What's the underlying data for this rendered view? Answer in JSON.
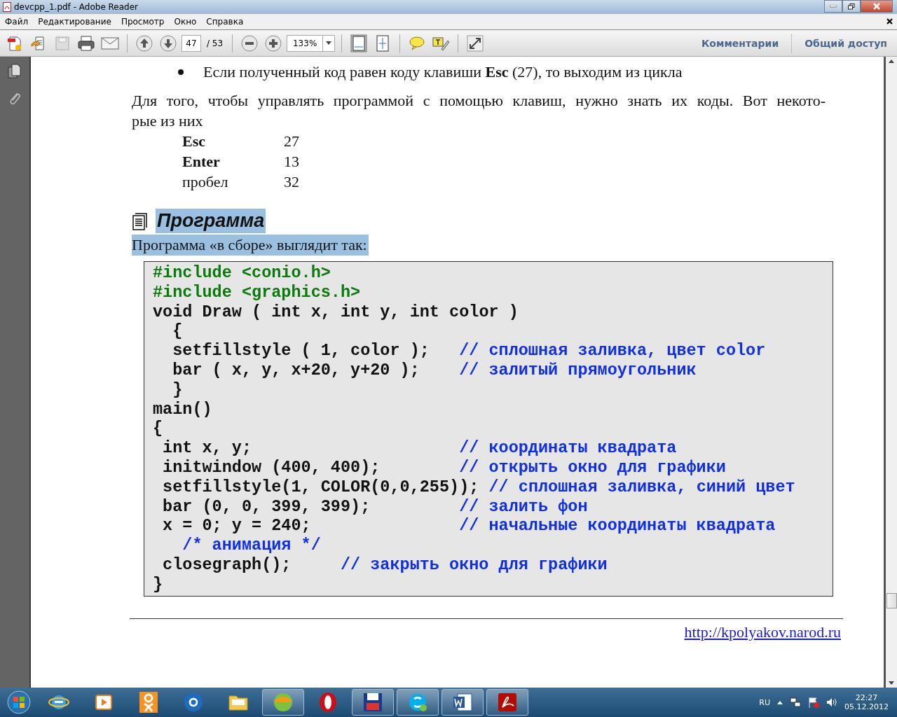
{
  "window": {
    "title": "devcpp_1.pdf - Adobe Reader"
  },
  "menu": [
    {
      "label": "Файл"
    },
    {
      "label": "Редактирование"
    },
    {
      "label": "Просмотр"
    },
    {
      "label": "Окно"
    },
    {
      "label": "Справка"
    }
  ],
  "toolbar": {
    "page": "47",
    "page_total": "/ 53",
    "zoom": "133%",
    "links": [
      {
        "label": "Комментарии"
      },
      {
        "label": "Общий доступ"
      }
    ]
  },
  "document": {
    "bullet": "Если полученный код равен коду клавиши **Esc** (27), то выходим из цикла",
    "paragraph_lines": [
      "Для того, чтобы управлять программой с помощью клавиш, нужно знать их коды. Вот некото-",
      "рые из них"
    ],
    "keys": [
      {
        "key": "Esc",
        "code": "27",
        "bold": true
      },
      {
        "key": "Enter",
        "code": "13",
        "bold": true
      },
      {
        "key": "пробел",
        "code": "32",
        "bold": false
      }
    ],
    "heading": {
      "text": "Программа",
      "selected": true
    },
    "intro": {
      "text": "Программа «в сборе» выглядит так:",
      "selected": true
    },
    "code_lines": [
      {
        "kind": "directive",
        "code": "#include <conio.h>"
      },
      {
        "kind": "directive",
        "code": "#include <graphics.h>"
      },
      {
        "kind": "plain",
        "code": "void Draw ( int x, int y, int color )"
      },
      {
        "kind": "plain",
        "code": "  {"
      },
      {
        "kind": "aligned",
        "code": "  setfillstyle ( 1, color );",
        "comment": "// сплошная заливка, цвет color"
      },
      {
        "kind": "aligned",
        "code": "  bar ( x, y, x+20, y+20 );",
        "comment": "// залитый прямоугольник"
      },
      {
        "kind": "plain",
        "code": "  }"
      },
      {
        "kind": "plain",
        "code": "main()"
      },
      {
        "kind": "plain",
        "code": "{"
      },
      {
        "kind": "aligned",
        "code": " int x, y;",
        "comment": "// координаты квадрата"
      },
      {
        "kind": "aligned",
        "code": " initwindow (400, 400);",
        "comment": "// открыть окно для графики"
      },
      {
        "kind": "aligned",
        "code": " setfillstyle(1, COLOR(0,0,255));",
        "comment": "// сплошная заливка, синий цвет"
      },
      {
        "kind": "aligned",
        "code": " bar (0, 0, 399, 399);",
        "comment": "// залить фон"
      },
      {
        "kind": "aligned",
        "code": " x = 0; y = 240;",
        "comment": "// начальные координаты квадрата"
      },
      {
        "kind": "comment",
        "code": "   /* анимация */"
      },
      {
        "kind": "inline",
        "code": " closegraph();",
        "comment": "// закрыть окно для графики"
      },
      {
        "kind": "plain",
        "code": "}"
      }
    ],
    "footer_link": "http://kpolyakov.narod.ru"
  },
  "taskbar": {
    "apps": [
      {
        "kind": "ie",
        "open": false
      },
      {
        "kind": "player",
        "open": false
      },
      {
        "kind": "ok",
        "open": false
      },
      {
        "kind": "mail",
        "open": false
      },
      {
        "kind": "folder",
        "open": false
      },
      {
        "kind": "ball",
        "open": true
      },
      {
        "kind": "opera",
        "open": false
      },
      {
        "kind": "disk",
        "open": true
      },
      {
        "kind": "skype",
        "open": true
      },
      {
        "kind": "word",
        "open": true
      },
      {
        "kind": "pdf",
        "open": true
      }
    ],
    "language": "RU",
    "time": "22:27",
    "date": "05.12.2012"
  }
}
